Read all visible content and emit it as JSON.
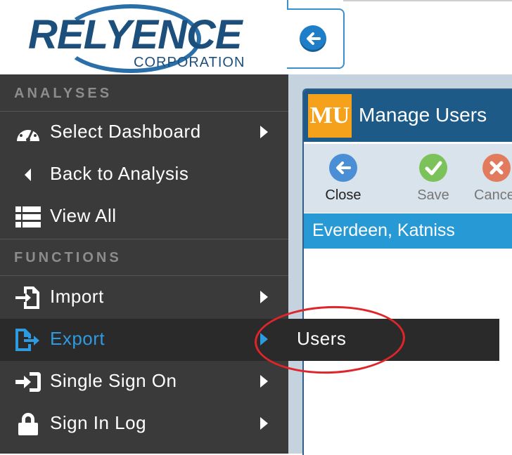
{
  "logo": {
    "brand": "RELYENCE",
    "sub": "CORPORATION"
  },
  "sidebar": {
    "section1": "ANALYSES",
    "items1": [
      {
        "label": "Select Dashboard",
        "icon": "dashboard-gauge-icon"
      },
      {
        "label": "Back to Analysis",
        "icon": "back-arrow-icon"
      },
      {
        "label": "View All",
        "icon": "list-view-icon"
      }
    ],
    "section2": "FUNCTIONS",
    "items2": [
      {
        "label": "Import",
        "icon": "import-icon"
      },
      {
        "label": "Export",
        "icon": "export-icon"
      },
      {
        "label": "Single Sign On",
        "icon": "sign-on-icon"
      },
      {
        "label": "Sign In Log",
        "icon": "lock-icon"
      }
    ],
    "active_color": "#2e9ae0"
  },
  "submenu": {
    "item": "Users"
  },
  "window": {
    "badge": "MU",
    "title": "Manage Users",
    "toolbar": {
      "close": "Close",
      "save": "Save",
      "cancel": "Cance"
    },
    "list": [
      "Everdeen, Katniss"
    ]
  }
}
